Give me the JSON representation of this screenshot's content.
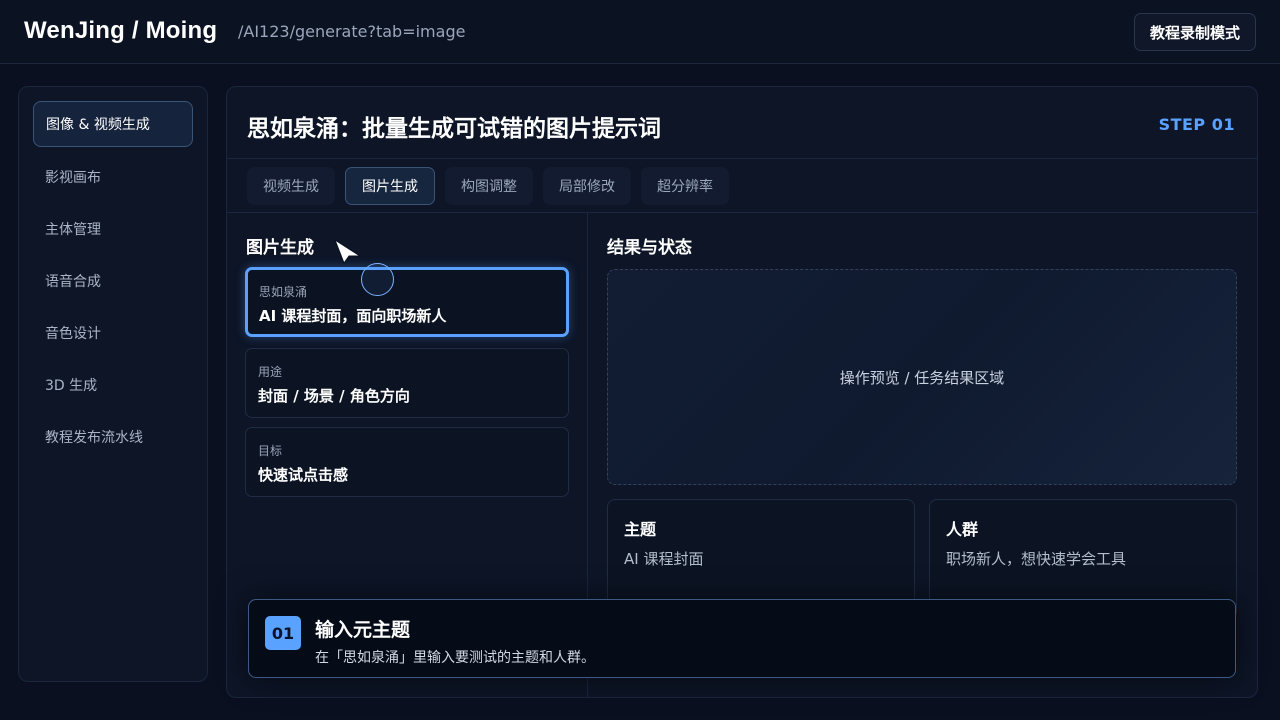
{
  "header": {
    "brand": "WenJing / Moing",
    "path": "/AI123/generate?tab=image",
    "record_mode_label": "教程录制模式"
  },
  "sidebar": {
    "items": [
      {
        "label": "图像 & 视频生成",
        "active": true
      },
      {
        "label": "影视画布"
      },
      {
        "label": "主体管理"
      },
      {
        "label": "语音合成"
      },
      {
        "label": "音色设计"
      },
      {
        "label": "3D 生成"
      },
      {
        "label": "教程发布流水线"
      }
    ]
  },
  "main": {
    "title": "思如泉涌：批量生成可试错的图片提示词",
    "step": "STEP 01",
    "tabs": [
      {
        "label": "视频生成"
      },
      {
        "label": "图片生成",
        "active": true
      },
      {
        "label": "构图调整"
      },
      {
        "label": "局部修改"
      },
      {
        "label": "超分辨率"
      }
    ],
    "left": {
      "section_title": "图片生成",
      "fields": [
        {
          "label": "思如泉涌",
          "value": "AI 课程封面，面向职场新人",
          "focused": true
        },
        {
          "label": "用途",
          "value": "封面 / 场景 / 角色方向"
        },
        {
          "label": "目标",
          "value": "快速试点击感"
        }
      ]
    },
    "right": {
      "section_title": "结果与状态",
      "preview_text": "操作预览 / 任务结果区域",
      "cards": [
        {
          "title": "主题",
          "text": "AI 课程封面"
        },
        {
          "title": "人群",
          "text": "职场新人，想快速学会工具"
        }
      ]
    }
  },
  "tutorial": {
    "step_number": "01",
    "title": "输入元主题",
    "description": "在「思如泉涌」里输入要测试的主题和人群。"
  },
  "colors": {
    "accent": "#5aa2ff",
    "background": "#0a1020",
    "panel": "#0d1527"
  }
}
